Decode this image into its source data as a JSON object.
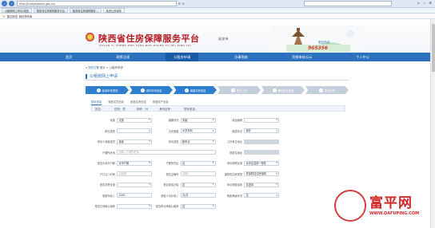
{
  "browser": {
    "url": "http://hudcshaanxi.gov.cn/",
    "search_placeholder": "",
    "tabs": [
      "公租房网上申请-陕西",
      "陕西省住房保障服务平台",
      "陕西省住房保障服务...",
      "陕西住房保障"
    ],
    "favorites": [
      "建议网站",
      "网页快讯库"
    ]
  },
  "site": {
    "title": "陕西省住房保障服务平台",
    "subtitle": "SHAAN XI SHENG ZHU FANG BAO ZHANG FU WU PING TAI",
    "city": "延安市",
    "hotline_label": "服务热线",
    "hotline": "965356"
  },
  "nav": {
    "items": [
      "首页",
      "政策法规",
      "公租房申请",
      "办事指南",
      "资格审核公示",
      "个人中心"
    ],
    "active_index": 2
  },
  "breadcrumb": {
    "home": "您的位置",
    "path": "首页 > 公租房申请"
  },
  "panel": {
    "title": "公租房网上申请"
  },
  "steps": [
    {
      "label": "阅读申请须知",
      "done": true
    },
    {
      "label": "填写申请信息",
      "done": true
    },
    {
      "label": "填报共有信息",
      "done": true
    },
    {
      "label": "附件上传",
      "done": false
    },
    {
      "label": "确认提交信息",
      "done": false
    },
    {
      "label": "申请完成",
      "done": false
    }
  ],
  "subtabs": [
    "基本信息",
    "家庭成员信息",
    "家庭住房信息",
    "家庭财产信息"
  ],
  "summary": {
    "name_label": "姓名：",
    "name_value": "",
    "gender_label": "性别：",
    "gender_value": "男",
    "age_label": "年龄：",
    "age_value": "28",
    "id_label": "身份证号：",
    "id_value": "",
    "phone_label": "联系电话：",
    "phone_value": ""
  },
  "form": {
    "rows": [
      [
        {
          "label": "民族",
          "value": "汉族",
          "select": true
        },
        {
          "label": "婚姻状况",
          "value": "未婚",
          "select": true
        },
        {
          "label": "政治面貌",
          "value": "",
          "select": true
        }
      ],
      [
        {
          "label": "职业类别",
          "value": "",
          "select": true
        },
        {
          "label": "文化程度",
          "value": "大学本科",
          "select": true
        },
        {
          "label": "健康状况",
          "value": "良好",
          "select": true
        }
      ],
      [
        {
          "label": "申请人家庭成员",
          "value": "单身",
          "select": true
        },
        {
          "label": "申请类型",
          "value": "新申请",
          "select": true
        },
        {
          "label": "工作单位地址",
          "value": "",
          "select": false,
          "blurred": true
        }
      ],
      [
        {
          "label": "户籍所在地",
          "value": "请输入户籍所在地",
          "placeholder": true,
          "wide": true
        },
        {
          "label": "现居住地址",
          "value": "",
          "select": false,
          "blurred": true
        }
      ],
      [
        {
          "label": "是否为本市户籍",
          "value": "本市户籍",
          "select": true
        },
        {
          "label": "户籍所在区",
          "value": "否",
          "select": true
        },
        {
          "label": "申请房屋区域",
          "value": "全省区县统一配售",
          "select": true
        }
      ],
      [
        {
          "label": "户口迁入时间",
          "value": "请选择",
          "placeholder": true
        },
        {
          "label": "居住证编号",
          "value": "请输入",
          "placeholder": true
        },
        {
          "label": "保障性住房类型",
          "value": "低保障性住房保障",
          "select": true
        }
      ],
      [
        {
          "label": "是否享受优惠",
          "value": "",
          "select": true
        },
        {
          "label": "是否参加社保",
          "value": "否",
          "select": true
        },
        {
          "label": "申请家庭结构",
          "value": "请选择",
          "select": true
        }
      ],
      [
        {
          "label": "家庭年收入",
          "value": "2000",
          "select": false
        },
        {
          "label": "家庭人均月收入",
          "value": "元/月",
          "select": false
        },
        {
          "label": "残疾等级状况",
          "value": "否",
          "select": true
        }
      ],
      [
        {
          "label": "是否已领取公租房",
          "value": "",
          "select": true
        },
        {
          "label": "是否申请承租公租房",
          "value": "否",
          "select": true
        },
        {
          "label": "",
          "value": "",
          "select": false,
          "empty": true
        }
      ]
    ]
  },
  "watermark": {
    "brand": "富平网",
    "url": "WWW.DAFUPING.COM"
  },
  "colors": {
    "accent": "#2b71bd",
    "title_red": "#b3191f",
    "step_done": "#2f7fd0",
    "step_todo": "#c4cfdb"
  }
}
